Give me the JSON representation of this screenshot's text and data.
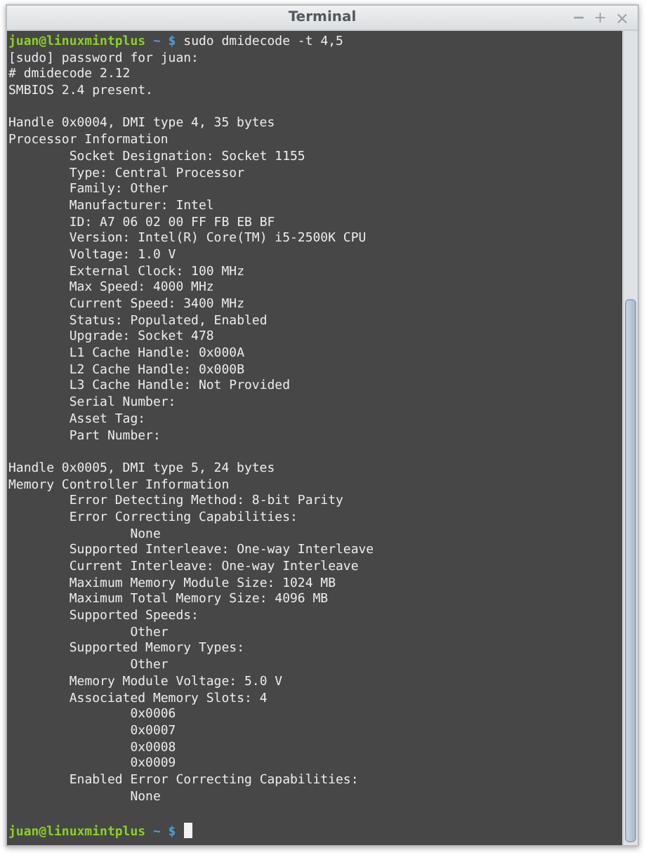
{
  "window": {
    "title": "Terminal",
    "controls": [
      {
        "kind": "minimize",
        "label": "−"
      },
      {
        "kind": "maximize",
        "label": "+"
      },
      {
        "kind": "close",
        "label": "×"
      }
    ]
  },
  "terminal": {
    "lines": [
      {
        "kind": "prompt",
        "user_host": "juan@linuxmintplus",
        "path": "~",
        "symbol": "$",
        "command": "sudo dmidecode -t 4,5"
      },
      {
        "kind": "output",
        "text": "[sudo] password for juan:"
      },
      {
        "kind": "output",
        "text": "# dmidecode 2.12"
      },
      {
        "kind": "output",
        "text": "SMBIOS 2.4 present."
      },
      {
        "kind": "blank"
      },
      {
        "kind": "output",
        "text": "Handle 0x0004, DMI type 4, 35 bytes"
      },
      {
        "kind": "output",
        "text": "Processor Information"
      },
      {
        "kind": "output",
        "text": "\tSocket Designation: Socket 1155"
      },
      {
        "kind": "output",
        "text": "\tType: Central Processor"
      },
      {
        "kind": "output",
        "text": "\tFamily: Other"
      },
      {
        "kind": "output",
        "text": "\tManufacturer: Intel"
      },
      {
        "kind": "output",
        "text": "\tID: A7 06 02 00 FF FB EB BF"
      },
      {
        "kind": "output",
        "text": "\tVersion: Intel(R) Core(TM) i5-2500K CPU"
      },
      {
        "kind": "output",
        "text": "\tVoltage: 1.0 V"
      },
      {
        "kind": "output",
        "text": "\tExternal Clock: 100 MHz"
      },
      {
        "kind": "output",
        "text": "\tMax Speed: 4000 MHz"
      },
      {
        "kind": "output",
        "text": "\tCurrent Speed: 3400 MHz"
      },
      {
        "kind": "output",
        "text": "\tStatus: Populated, Enabled"
      },
      {
        "kind": "output",
        "text": "\tUpgrade: Socket 478"
      },
      {
        "kind": "output",
        "text": "\tL1 Cache Handle: 0x000A"
      },
      {
        "kind": "output",
        "text": "\tL2 Cache Handle: 0x000B"
      },
      {
        "kind": "output",
        "text": "\tL3 Cache Handle: Not Provided"
      },
      {
        "kind": "output",
        "text": "\tSerial Number:"
      },
      {
        "kind": "output",
        "text": "\tAsset Tag:"
      },
      {
        "kind": "output",
        "text": "\tPart Number:"
      },
      {
        "kind": "blank"
      },
      {
        "kind": "output",
        "text": "Handle 0x0005, DMI type 5, 24 bytes"
      },
      {
        "kind": "output",
        "text": "Memory Controller Information"
      },
      {
        "kind": "output",
        "text": "\tError Detecting Method: 8-bit Parity"
      },
      {
        "kind": "output",
        "text": "\tError Correcting Capabilities:"
      },
      {
        "kind": "output",
        "text": "\t\tNone"
      },
      {
        "kind": "output",
        "text": "\tSupported Interleave: One-way Interleave"
      },
      {
        "kind": "output",
        "text": "\tCurrent Interleave: One-way Interleave"
      },
      {
        "kind": "output",
        "text": "\tMaximum Memory Module Size: 1024 MB"
      },
      {
        "kind": "output",
        "text": "\tMaximum Total Memory Size: 4096 MB"
      },
      {
        "kind": "output",
        "text": "\tSupported Speeds:"
      },
      {
        "kind": "output",
        "text": "\t\tOther"
      },
      {
        "kind": "output",
        "text": "\tSupported Memory Types:"
      },
      {
        "kind": "output",
        "text": "\t\tOther"
      },
      {
        "kind": "output",
        "text": "\tMemory Module Voltage: 5.0 V"
      },
      {
        "kind": "output",
        "text": "\tAssociated Memory Slots: 4"
      },
      {
        "kind": "output",
        "text": "\t\t0x0006"
      },
      {
        "kind": "output",
        "text": "\t\t0x0007"
      },
      {
        "kind": "output",
        "text": "\t\t0x0008"
      },
      {
        "kind": "output",
        "text": "\t\t0x0009"
      },
      {
        "kind": "output",
        "text": "\tEnabled Error Correcting Capabilities:"
      },
      {
        "kind": "output",
        "text": "\t\tNone"
      },
      {
        "kind": "blank"
      },
      {
        "kind": "prompt",
        "user_host": "juan@linuxmintplus",
        "path": "~",
        "symbol": "$",
        "cursor": true
      }
    ]
  }
}
